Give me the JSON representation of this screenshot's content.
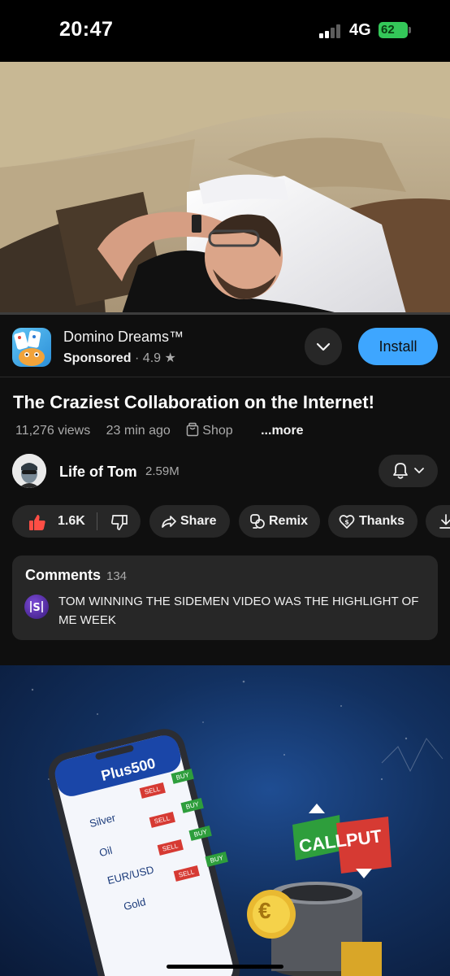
{
  "status_bar": {
    "time": "20:47",
    "network": "4G",
    "battery": "62"
  },
  "ad": {
    "app_name": "Domino Dreams™",
    "sponsored": "Sponsored",
    "separator": "·",
    "rating": "4.9",
    "install_label": "Install"
  },
  "video": {
    "title": "The Craziest Collaboration on the Internet!",
    "views": "11,276 views",
    "time_ago": "23 min ago",
    "shop": "Shop",
    "more": "...more"
  },
  "channel": {
    "name": "Life of Tom",
    "subscribers": "2.59M"
  },
  "actions": {
    "likes": "1.6K",
    "share": "Share",
    "remix": "Remix",
    "thanks": "Thanks"
  },
  "comments": {
    "label": "Comments",
    "count": "134",
    "top_comment": "TOM WINNING THE SIDEMEN VIDEO WAS THE HIGHLIGHT OF ME WEEK"
  },
  "promo": {
    "brand": "Plus500",
    "rows": [
      {
        "name": "Silver",
        "sell": "SELL",
        "buy": "BUY"
      },
      {
        "name": "Oil",
        "sell": "SELL",
        "buy": "BUY"
      },
      {
        "name": "EUR/USD",
        "sell": "SELL",
        "buy": "BUY"
      },
      {
        "name": "Gold",
        "sell": "SELL",
        "buy": "BUY"
      }
    ],
    "call": "CALL",
    "put": "PUT",
    "euro": "€"
  },
  "colors": {
    "accent": "#3ea6ff",
    "background": "#0f0f0f",
    "pill": "#272727",
    "like": "#ff4e45",
    "battery": "#34c759"
  }
}
